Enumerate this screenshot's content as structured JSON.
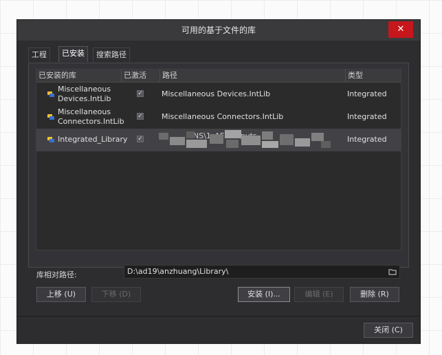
{
  "dialog": {
    "title": "可用的基于文件的库",
    "close_icon": "close-x-icon",
    "tabs": [
      {
        "label": "工程",
        "active": false
      },
      {
        "label": "已安装",
        "active": true
      },
      {
        "label": "搜索路径",
        "active": false
      }
    ],
    "columns": {
      "installed_lib": "已安装的库",
      "activated": "已激活",
      "path": "路径",
      "type": "类型"
    },
    "rows": [
      {
        "name": "Miscellaneous Devices.IntLib",
        "activated": true,
        "path": "Miscellaneous Devices.IntLib",
        "type": "Integrated",
        "selected": false
      },
      {
        "name": "Miscellaneous Connectors.IntLib",
        "activated": true,
        "path": "Miscellaneous Connectors.IntLib",
        "type": "Integrated",
        "selected": false
      },
      {
        "name": "Integrated_Library",
        "activated": true,
        "path": "NS\\1_AF              Outputs",
        "type": "Integrated",
        "selected": true
      }
    ],
    "library_path_label": "库相对路径:",
    "library_path_value": "D:\\ad19\\anzhuang\\Library\\",
    "buttons": {
      "move_up": "上移 (U)",
      "move_down": "下移 (D)",
      "install": "安装 (I)...",
      "edit": "编辑 (E)",
      "remove": "删除 (R)",
      "close": "关闭 (C)"
    }
  }
}
